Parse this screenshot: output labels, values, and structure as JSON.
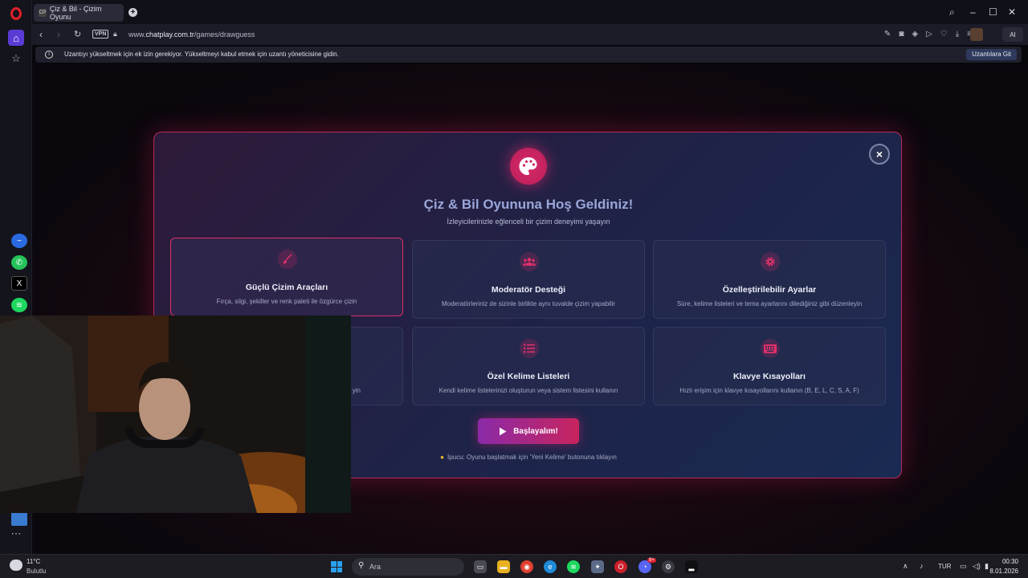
{
  "browser": {
    "tab_title": "Çiz & Bil - Çizim Oyunu",
    "tab_favicon": "CP",
    "url_prefix": "www.",
    "url_domain": "chatplay.com.tr",
    "url_path": "/games/drawguess",
    "vpn_label": "VPN",
    "ai_label": "AI",
    "infobar_text": "Uzantıyı yükseltmek için ek izin gerekiyor. Yükseltmeyi kabul etmek için uzantı yöneticisine gidin.",
    "infobar_button": "Uzantılara Git"
  },
  "modal": {
    "title": "Çiz & Bil Oyununa Hoş Geldiniz!",
    "subtitle": "İzleyicilerinizle eğlenceli bir çizim deneyimi yaşayın",
    "features": [
      {
        "title": "Güçlü Çizim Araçları",
        "desc": "Fırça, silgi, şekiller ve renk paleti ile özgürce çizin",
        "icon": "brush-icon"
      },
      {
        "title": "Moderatör Desteği",
        "desc": "Moderatörleriniz de sizinle birlikte aynı tuvalde çizim yapabilir",
        "icon": "users-icon"
      },
      {
        "title": "Özelleştirilebilir Ayarlar",
        "desc": "Süre, kelime listeleri ve tema ayarlarını dilediğiniz gibi düzenleyin",
        "icon": "gear-icon"
      },
      {
        "title": "",
        "desc": "yin",
        "icon": ""
      },
      {
        "title": "Özel Kelime Listeleri",
        "desc": "Kendi kelime listelerinizi oluşturun veya sistem listesini kullanın",
        "icon": "list-icon"
      },
      {
        "title": "Klavye Kısayolları",
        "desc": "Hızlı erişim için klavye kısayollarını kullanın (B, E, L, C, S, A, F)",
        "icon": "keyboard-icon"
      }
    ],
    "start_button": "Başlayalım!",
    "tip": "İpucu: Oyunu başlatmak için 'Yeni Kelime' butonuna tıklayın"
  },
  "taskbar": {
    "weather_temp": "11°C",
    "weather_desc": "Bulutlu",
    "search_placeholder": "Ara",
    "language": "TUR",
    "time": "00:30",
    "date": "8.01.2026",
    "discord_badge": "9+"
  },
  "colors": {
    "accent": "#d92a6a",
    "brand_purple": "#8a2aa8",
    "modal_border": "#b52a5a"
  }
}
